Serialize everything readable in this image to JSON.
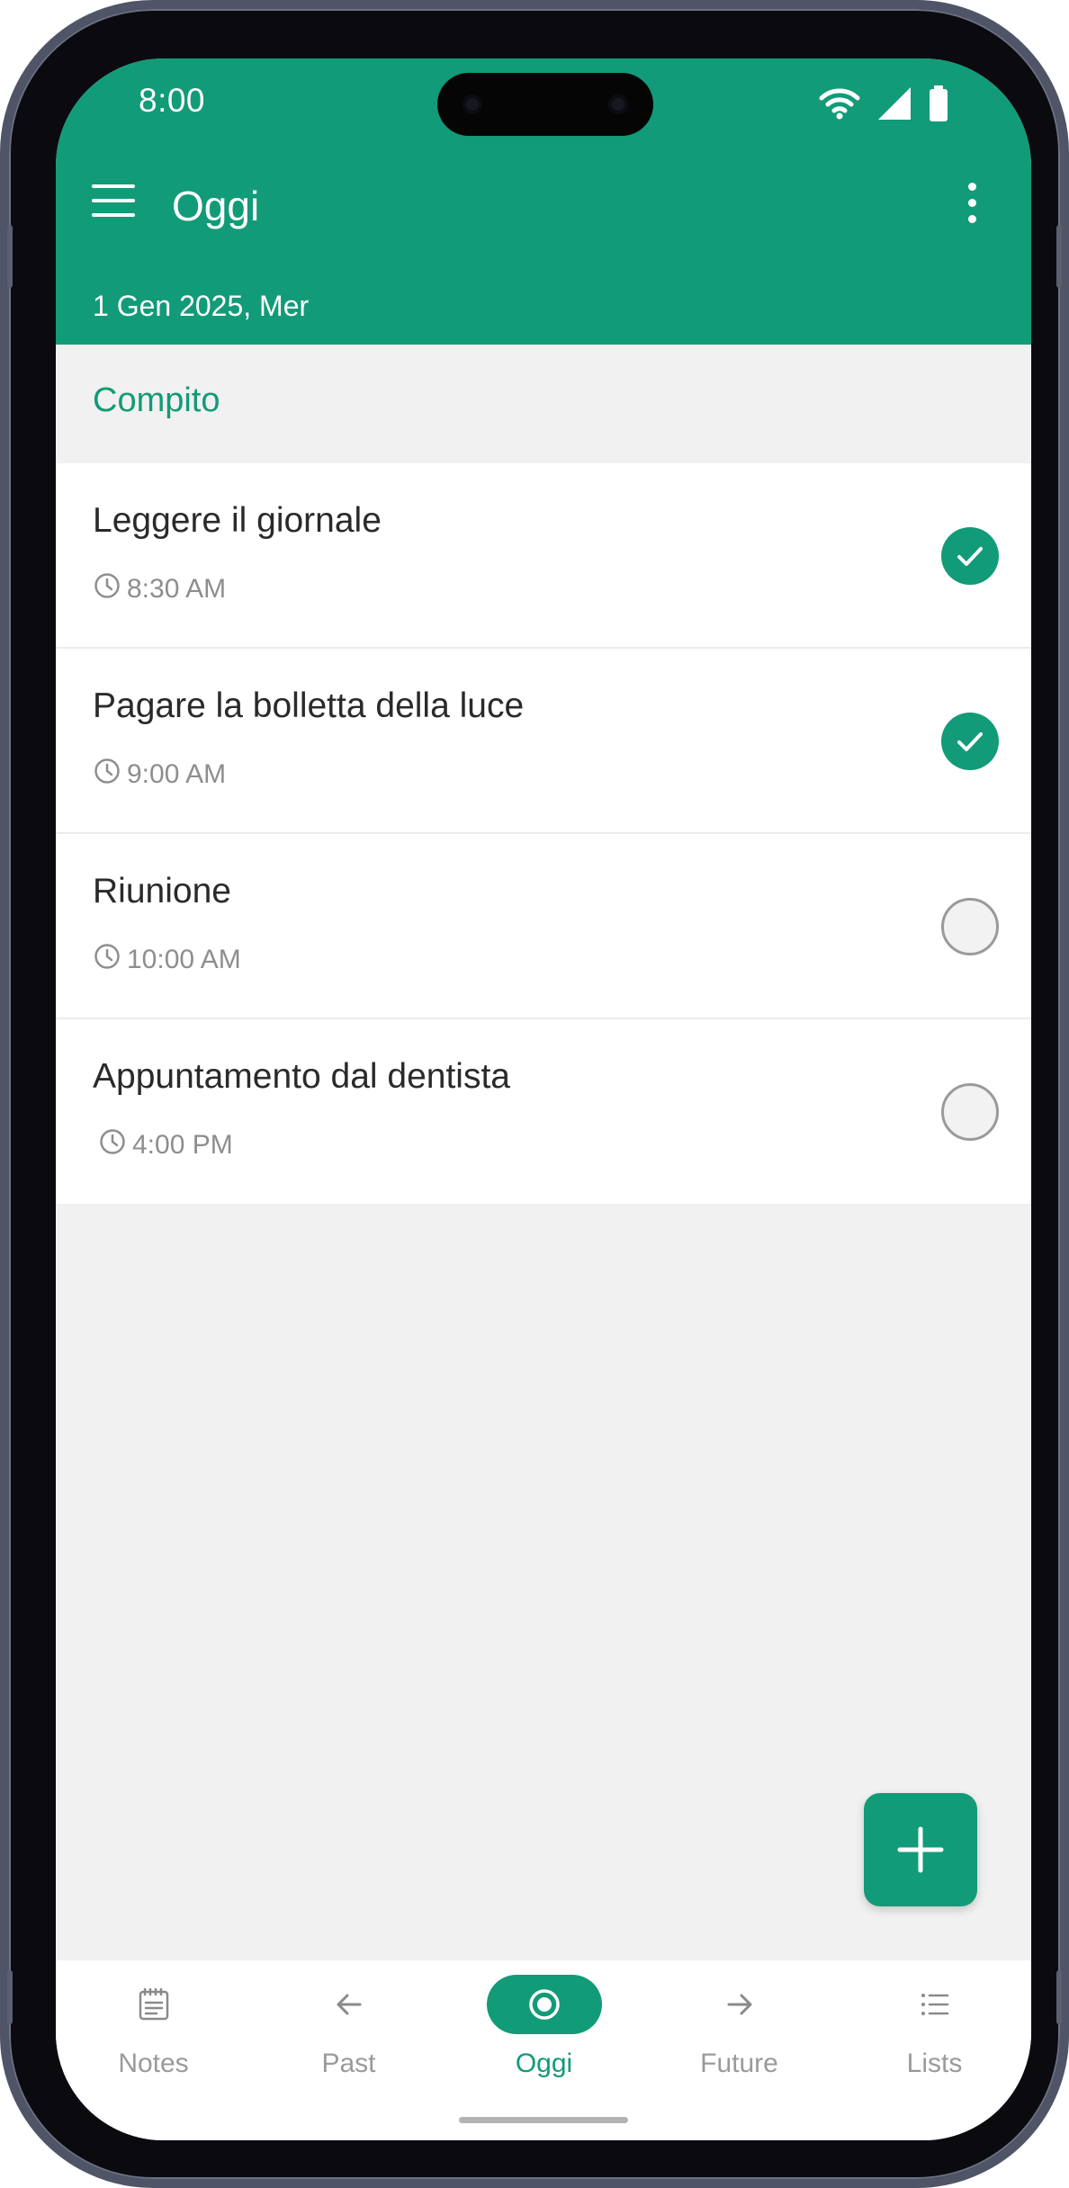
{
  "status_bar": {
    "time": "8:00"
  },
  "app_bar": {
    "title": "Oggi",
    "date": "1 Gen 2025, Mer",
    "menu_icon": "hamburger-menu-icon",
    "more_icon": "more-vertical-icon"
  },
  "section": {
    "title": "Compito"
  },
  "tasks": [
    {
      "title": "Leggere il giornale",
      "time": "8:30 AM",
      "done": true
    },
    {
      "title": "Pagare la bolletta della luce",
      "time": "9:00 AM",
      "done": true
    },
    {
      "title": "Riunione",
      "time": "10:00 AM",
      "done": false
    },
    {
      "title": "Appuntamento dal dentista",
      "time": "4:00 PM",
      "done": false
    }
  ],
  "fab": {
    "icon": "plus-icon"
  },
  "bottom_nav": {
    "items": [
      {
        "label": "Notes",
        "icon": "notes-icon",
        "active": false
      },
      {
        "label": "Past",
        "icon": "arrow-left-icon",
        "active": false
      },
      {
        "label": "Oggi",
        "icon": "today-target-icon",
        "active": true
      },
      {
        "label": "Future",
        "icon": "arrow-right-icon",
        "active": false
      },
      {
        "label": "Lists",
        "icon": "list-icon",
        "active": false
      }
    ]
  },
  "colors": {
    "accent": "#129b78",
    "background": "#f1f1f1",
    "text_primary": "#2a2a2a",
    "text_secondary": "#8e8e8e"
  }
}
